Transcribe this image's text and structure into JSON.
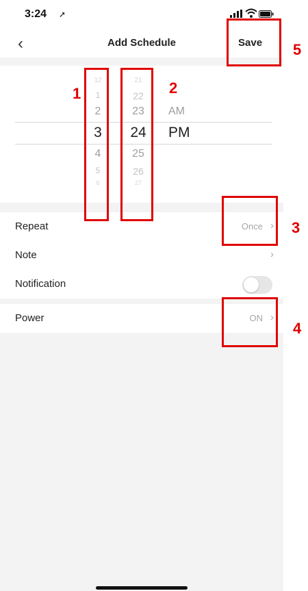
{
  "status_bar": {
    "time": "3:24"
  },
  "nav": {
    "back": "‹",
    "title": "Add Schedule",
    "save_label": "Save"
  },
  "picker": {
    "hours": [
      "12",
      "1",
      "2",
      "3",
      "4",
      "5",
      "6"
    ],
    "minutes": [
      "21",
      "22",
      "23",
      "24",
      "25",
      "26",
      "27"
    ],
    "period": [
      "AM",
      "PM"
    ],
    "selected": {
      "hour": "3",
      "minute": "24",
      "period": "PM"
    }
  },
  "settings": {
    "repeat": {
      "label": "Repeat",
      "value": "Once"
    },
    "note": {
      "label": "Note",
      "value": ""
    },
    "notification": {
      "label": "Notification",
      "enabled": false
    },
    "power": {
      "label": "Power",
      "value": "ON"
    }
  },
  "chevron": "›",
  "annotations": [
    "1",
    "2",
    "3",
    "4",
    "5"
  ],
  "colors": {
    "annotation": "#e00000",
    "background": "#f3f3f3",
    "muted_text": "#a7a7a7"
  }
}
